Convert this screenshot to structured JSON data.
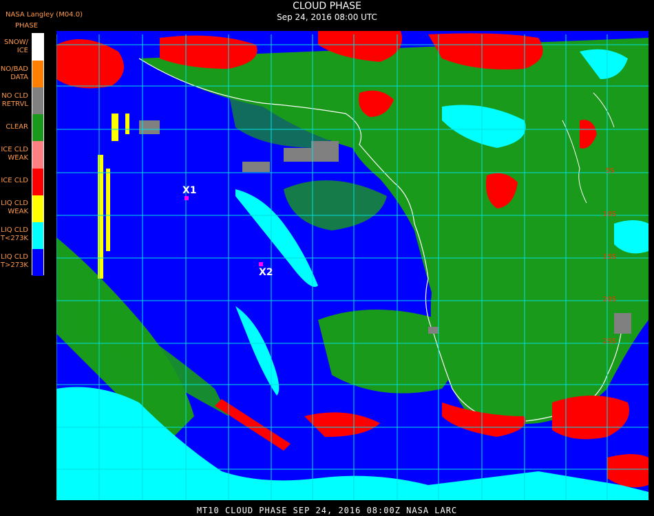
{
  "header": {
    "logo_text": "NASA Langley (M04.0)",
    "legend_heading": "PHASE",
    "title": "CLOUD PHASE",
    "subtitle": "Sep 24, 2016 08:00 UTC"
  },
  "footer": {
    "text": "MT10   CLOUD PHASE   SEP 24, 2016 08:00Z   NASA LARC"
  },
  "legend": [
    {
      "label": "SNOW/\nICE",
      "color": "#ffffff"
    },
    {
      "label": "NO/BAD\nDATA",
      "color": "#ff8000"
    },
    {
      "label": "NO CLD\nRETRVL",
      "color": "#808080"
    },
    {
      "label": "CLEAR",
      "color": "#1a9a1a"
    },
    {
      "label": "ICE CLD\nWEAK",
      "color": "#ff8080"
    },
    {
      "label": "ICE CLD",
      "color": "#ff0000"
    },
    {
      "label": "LIQ CLD\nWEAK",
      "color": "#ffff00"
    },
    {
      "label": "LIQ CLD\nT<273K",
      "color": "#00ffff"
    },
    {
      "label": "LIQ CLD\nT>273K",
      "color": "#0000ff"
    }
  ],
  "markers": [
    {
      "label": "X1",
      "color": "#ff00ff"
    },
    {
      "label": "X2",
      "color": "#ff00ff"
    }
  ],
  "lat_labels": [
    "5S",
    "10S",
    "15S",
    "20S",
    "25S"
  ],
  "colors": {
    "background": "#000000",
    "ocean_liquid": "#0000ff",
    "land_clear": "#1a9a1a",
    "ice_cloud": "#ff0000",
    "liquid_cold": "#00ffff",
    "grid_lines": "#00e0e0",
    "coastline": "#ffffff"
  }
}
